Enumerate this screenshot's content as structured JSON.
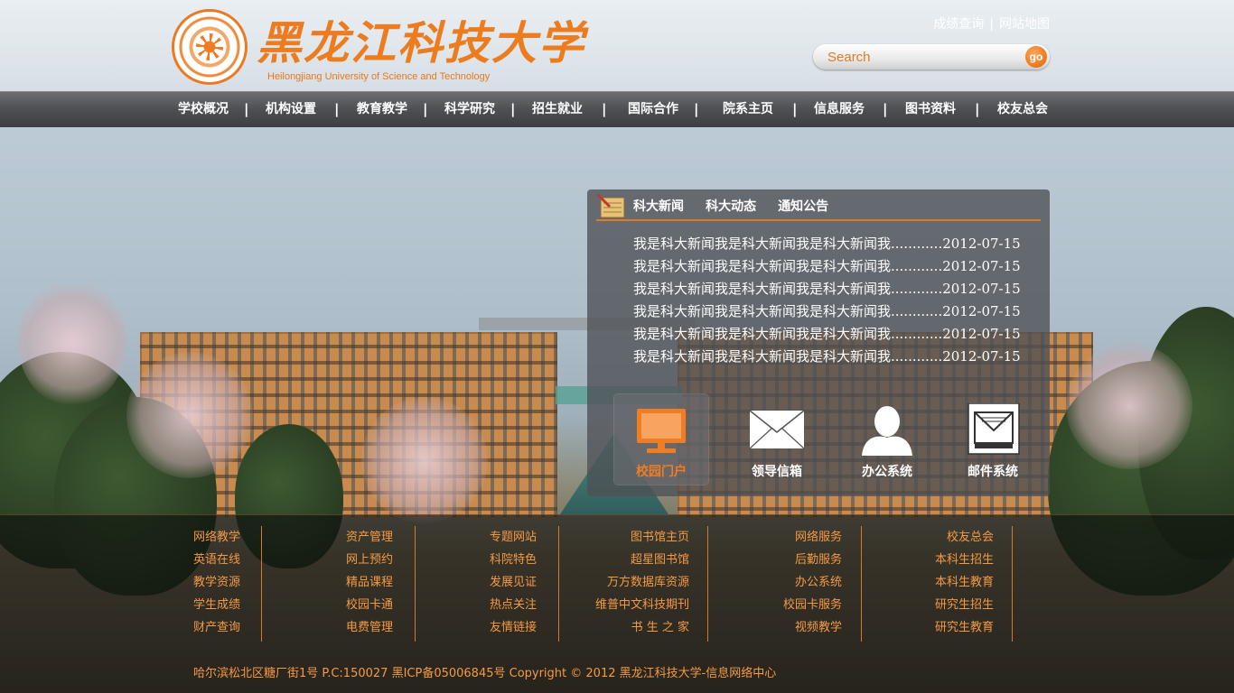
{
  "brand": {
    "name_cn": "黑龙江科技大学",
    "name_en": "Heilongjiang University of Science and Technology"
  },
  "top_links": [
    "成绩查询",
    "网站地图"
  ],
  "search": {
    "placeholder": "Search",
    "button": "go"
  },
  "nav": [
    "学校概况",
    "机构设置",
    "教育教学",
    "科学研究",
    "招生就业",
    "国际合作",
    "院系主页",
    "信息服务",
    "图书资料",
    "校友总会"
  ],
  "news": {
    "tabs": [
      "科大新闻",
      "科大动态",
      "通知公告"
    ],
    "items": [
      "我是科大新闻我是科大新闻我是科大新闻我............2012-07-15",
      "我是科大新闻我是科大新闻我是科大新闻我............2012-07-15",
      "我是科大新闻我是科大新闻我是科大新闻我............2012-07-15",
      "我是科大新闻我是科大新闻我是科大新闻我............2012-07-15",
      "我是科大新闻我是科大新闻我是科大新闻我............2012-07-15",
      "我是科大新闻我是科大新闻我是科大新闻我............2012-07-15"
    ]
  },
  "quick_links": [
    {
      "label": "校园门户",
      "icon": "monitor-icon",
      "active": true
    },
    {
      "label": "领导信箱",
      "icon": "envelope-icon",
      "active": false
    },
    {
      "label": "办公系统",
      "icon": "user-icon",
      "active": false
    },
    {
      "label": "邮件系统",
      "icon": "mail-icon",
      "active": false
    }
  ],
  "footer": {
    "columns": [
      [
        "网络教学",
        "英语在线",
        "教学资源",
        "学生成绩",
        "财产查询"
      ],
      [
        "资产管理",
        "网上预约",
        "精品课程",
        "校园卡通",
        "电费管理"
      ],
      [
        "专题网站",
        "科院特色",
        "发展见证",
        "热点关注",
        "友情链接"
      ],
      [
        "图书馆主页",
        "超星图书馆",
        "万方数据库资源",
        "维普中文科技期刊",
        "书 生 之 家"
      ],
      [
        "网络服务",
        "后勤服务",
        "办公系统",
        "校园卡服务",
        "视频教学"
      ],
      [
        "校友总会",
        "本科生招生",
        "本科生教育",
        "研究生招生",
        "研究生教育"
      ]
    ],
    "copyright": "哈尔滨松北区糖厂街1号 P.C:150027  黑ICP备05006845号   Copyright © 2012  黑龙江科技大学-信息网络中心"
  },
  "colors": {
    "accent": "#f07d22",
    "footer_link": "#f39a45"
  }
}
